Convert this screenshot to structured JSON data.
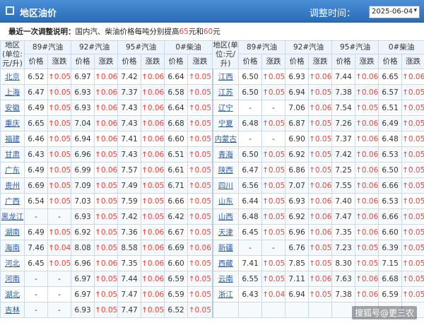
{
  "header": {
    "title": "地区油价",
    "adjust_label": "调整时间：",
    "date_value": "2025-06-04",
    "arrow": "▾"
  },
  "notice": {
    "prefix": "最近一次调整说明：",
    "text1": "国内汽、柴油价格每吨分别提高",
    "amount1": "65",
    "text2": "元和",
    "amount2": "60",
    "text3": "元"
  },
  "columns": {
    "region": "地区(单位:元/升)",
    "fuels": [
      "89#汽油",
      "92#汽油",
      "95#汽油",
      "0#柴油"
    ],
    "price": "价格",
    "change": "涨跌"
  },
  "rows": [
    {
      "l": {
        "name": "北京",
        "v": [
          "6.52",
          "↑0.05",
          "6.97",
          "↑0.06",
          "7.42",
          "↑0.06",
          "6.64",
          "↑0.05"
        ]
      },
      "r": {
        "name": "江西",
        "v": [
          "6.50",
          "↑0.05",
          "6.93",
          "↑0.06",
          "7.44",
          "↑0.06",
          "6.65",
          "↑0.06"
        ]
      }
    },
    {
      "l": {
        "name": "上海",
        "v": [
          "6.47",
          "↑0.05",
          "6.93",
          "↑0.06",
          "7.37",
          "↑0.06",
          "6.58",
          "↑0.05"
        ]
      },
      "r": {
        "name": "江苏",
        "v": [
          "6.50",
          "↑0.05",
          "6.94",
          "↑0.05",
          "7.38",
          "↑0.06",
          "6.57",
          "↑0.05"
        ]
      }
    },
    {
      "l": {
        "name": "安徽",
        "v": [
          "6.49",
          "↑0.05",
          "6.93",
          "↑0.06",
          "7.43",
          "↑0.06",
          "6.64",
          "↑0.05"
        ]
      },
      "r": {
        "name": "辽宁",
        "v": [
          "-",
          "-",
          "7.06",
          "↑0.06",
          "7.54",
          "↑0.05",
          "6.51",
          "↑0.05"
        ]
      }
    },
    {
      "l": {
        "name": "重庆",
        "v": [
          "6.65",
          "↑0.05",
          "7.04",
          "↑0.06",
          "7.43",
          "↑0.06",
          "6.68",
          "↑0.05"
        ]
      },
      "r": {
        "name": "宁夏",
        "v": [
          "6.48",
          "↑0.05",
          "6.87",
          "↑0.05",
          "7.26",
          "↑0.06",
          "6.49",
          "↑0.05"
        ]
      }
    },
    {
      "l": {
        "name": "福建",
        "v": [
          "6.46",
          "↑0.05",
          "6.94",
          "↑0.06",
          "7.41",
          "↑0.06",
          "6.60",
          "↑0.05"
        ]
      },
      "r": {
        "name": "内蒙古",
        "v": [
          "-",
          "-",
          "6.90",
          "↑0.05",
          "7.37",
          "↑0.06",
          "6.48",
          "↑0.05"
        ]
      }
    },
    {
      "l": {
        "name": "甘肃",
        "v": [
          "6.43",
          "↑0.05",
          "6.96",
          "↑0.05",
          "7.43",
          "↑0.06",
          "6.51",
          "↑0.05"
        ]
      },
      "r": {
        "name": "青海",
        "v": [
          "6.50",
          "↑0.05",
          "6.92",
          "↑0.05",
          "7.42",
          "↑0.06",
          "6.53",
          "↑0.05"
        ]
      }
    },
    {
      "l": {
        "name": "广东",
        "v": [
          "6.49",
          "↑0.05",
          "6.99",
          "↑0.06",
          "7.57",
          "↑0.06",
          "6.61",
          "↑0.05"
        ]
      },
      "r": {
        "name": "陕西",
        "v": [
          "6.47",
          "↑0.05",
          "6.86",
          "↑0.05",
          "7.25",
          "↑0.06",
          "6.50",
          "↑0.05"
        ]
      }
    },
    {
      "l": {
        "name": "贵州",
        "v": [
          "6.69",
          "↑0.05",
          "7.09",
          "↑0.05",
          "7.49",
          "↑0.05",
          "6.71",
          "↑0.05"
        ]
      },
      "r": {
        "name": "四川",
        "v": [
          "6.56",
          "↑0.05",
          "7.07",
          "↑0.06",
          "7.55",
          "↑0.06",
          "6.66",
          "↑0.05"
        ]
      }
    },
    {
      "l": {
        "name": "广西",
        "v": [
          "6.54",
          "↑0.05",
          "7.03",
          "↑0.05",
          "7.59",
          "↑0.05",
          "6.66",
          "↑0.05"
        ]
      },
      "r": {
        "name": "山东",
        "v": [
          "6.44",
          "↑0.05",
          "6.93",
          "↑0.06",
          "7.40",
          "↑0.06",
          "6.53",
          "↑0.05"
        ]
      }
    },
    {
      "l": {
        "name": "黑龙江",
        "v": [
          "-",
          "-",
          "6.93",
          "↑0.05",
          "7.42",
          "↑0.05",
          "6.42",
          "↑0.05"
        ]
      },
      "r": {
        "name": "山西",
        "v": [
          "6.48",
          "↑0.05",
          "6.92",
          "↑0.06",
          "7.47",
          "↑0.06",
          "6.66",
          "↑0.05"
        ]
      }
    },
    {
      "l": {
        "name": "湖南",
        "v": [
          "6.49",
          "↑0.05",
          "6.92",
          "↑0.05",
          "7.36",
          "↑0.06",
          "6.67",
          "↑0.05"
        ]
      },
      "r": {
        "name": "天津",
        "v": [
          "6.45",
          "↑0.05",
          "6.96",
          "↑0.06",
          "7.35",
          "↑0.06",
          "6.60",
          "↑0.05"
        ]
      }
    },
    {
      "l": {
        "name": "海南",
        "v": [
          "7.46",
          "↑0.04",
          "8.08",
          "↑0.05",
          "8.58",
          "↑0.06",
          "6.69",
          "↑0.06"
        ]
      },
      "r": {
        "name": "新疆",
        "v": [
          "-",
          "-",
          "6.76",
          "↑0.05",
          "7.23",
          "↑0.05",
          "6.39",
          "↑0.05"
        ]
      }
    },
    {
      "l": {
        "name": "河北",
        "v": [
          "6.45",
          "↑0.05",
          "6.96",
          "↑0.06",
          "7.35",
          "↑0.06",
          "6.60",
          "↑0.05"
        ]
      },
      "r": {
        "name": "西藏",
        "v": [
          "7.41",
          "↑0.05",
          "7.85",
          "↑0.05",
          "8.30",
          "↑0.05",
          "7.15",
          "↑0.05"
        ]
      }
    },
    {
      "l": {
        "name": "河南",
        "v": [
          "-",
          "-",
          "6.97",
          "↑0.05",
          "7.44",
          "↑0.06",
          "6.59",
          "↑0.05"
        ]
      },
      "r": {
        "name": "云南",
        "v": [
          "6.55",
          "↑0.05",
          "7.11",
          "↑0.06",
          "7.63",
          "↑0.06",
          "6.68",
          "↑0.05"
        ]
      }
    },
    {
      "l": {
        "name": "湖北",
        "v": [
          "-",
          "-",
          "6.97",
          "↑0.05",
          "7.47",
          "↑0.06",
          "6.59",
          "↑0.05"
        ]
      },
      "r": {
        "name": "浙江",
        "v": [
          "6.43",
          "↑0.04",
          "6.94",
          "↑0.05",
          "7.38",
          "↑0.06",
          "6.59",
          "↑0.05"
        ]
      }
    },
    {
      "l": {
        "name": "吉林",
        "v": [
          "-",
          "-",
          "6.93",
          "↑0.05",
          "7.47",
          "↑0.05",
          "6.52",
          "↑0.05"
        ]
      },
      "r": {
        "name": "",
        "v": [
          "",
          "",
          "",
          "",
          "",
          "",
          "",
          ""
        ]
      }
    }
  ],
  "watermark": "搜狐号@更三农"
}
